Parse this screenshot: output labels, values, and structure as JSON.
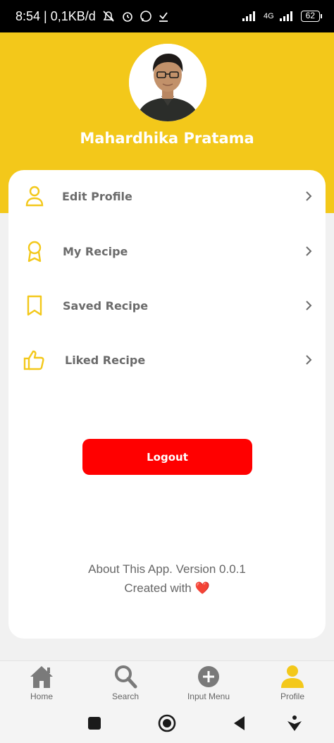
{
  "status_bar": {
    "time_speed": "8:54 | 0,1KB/d",
    "network": "4G",
    "battery": "62"
  },
  "profile": {
    "name": "Mahardhika Pratama"
  },
  "menu": {
    "items": [
      {
        "label": "Edit Profile",
        "icon": "user-icon"
      },
      {
        "label": "My Recipe",
        "icon": "award-icon"
      },
      {
        "label": "Saved Recipe",
        "icon": "bookmark-icon"
      },
      {
        "label": "Liked Recipe",
        "icon": "thumbs-up-icon"
      }
    ]
  },
  "logout_label": "Logout",
  "about": {
    "line1": "About This App. Version 0.0.1",
    "line2": "Created with",
    "heart": "❤️"
  },
  "bottom_nav": {
    "items": [
      {
        "label": "Home",
        "icon": "home-icon",
        "active": false
      },
      {
        "label": "Search",
        "icon": "search-icon",
        "active": false
      },
      {
        "label": "Input Menu",
        "icon": "plus-circle-icon",
        "active": false
      },
      {
        "label": "Profile",
        "icon": "person-icon",
        "active": true
      }
    ]
  },
  "colors": {
    "accent": "#f3c81a",
    "logout": "#ff0000",
    "text_muted": "#6b6b6b"
  }
}
